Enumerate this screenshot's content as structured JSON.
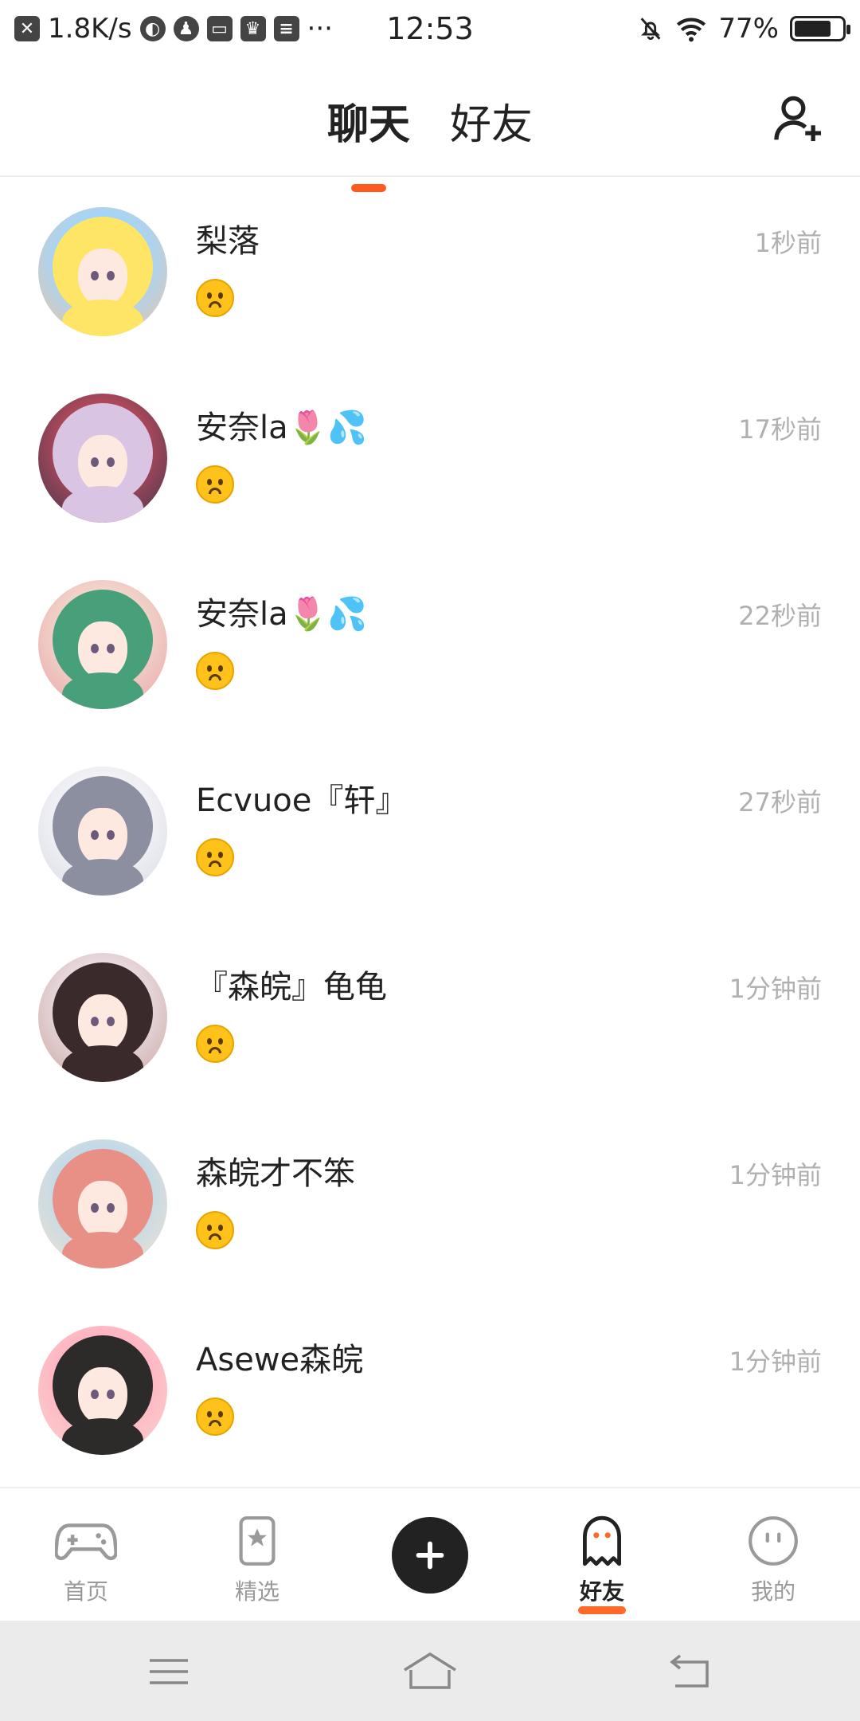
{
  "status_bar": {
    "speed": "1.8K/s",
    "more": "···",
    "time": "12:53",
    "battery": "77%",
    "battery_level": 0.77
  },
  "header": {
    "tabs": [
      {
        "label": "聊天",
        "active": true
      },
      {
        "label": "好友",
        "active": false
      }
    ]
  },
  "chats": [
    {
      "name": "梨落",
      "time": "1秒前",
      "avatar_colors": [
        "#f3c39a",
        "#ffe566",
        "#9fd6ff"
      ]
    },
    {
      "name": "安奈la🌷💦",
      "time": "17秒前",
      "avatar_colors": [
        "#3b3450",
        "#d9c4e3",
        "#b34a5a"
      ]
    },
    {
      "name": "安奈la🌷💦",
      "time": "22秒前",
      "avatar_colors": [
        "#e9a3a8",
        "#48a07a",
        "#f2d6cc"
      ]
    },
    {
      "name": "Ecvuoe『轩』",
      "time": "27秒前",
      "avatar_colors": [
        "#d9dbe6",
        "#8b8fa0",
        "#f3f3f6"
      ]
    },
    {
      "name": "『森皖』龟龟",
      "time": "1分钟前",
      "avatar_colors": [
        "#caa39a",
        "#3a2a2c",
        "#e9dce2"
      ]
    },
    {
      "name": "森皖才不笨",
      "time": "1分钟前",
      "avatar_colors": [
        "#f6e2cf",
        "#e88f86",
        "#bfd9e8"
      ]
    },
    {
      "name": "Asewe森皖",
      "time": "1分钟前",
      "avatar_colors": [
        "#f7d6d0",
        "#2d2a2a",
        "#ffb3c1"
      ]
    }
  ],
  "bottom_nav": {
    "items": [
      {
        "label": "首页",
        "icon": "gamepad-icon"
      },
      {
        "label": "精选",
        "icon": "bookmark-star-icon"
      },
      {
        "label": "",
        "icon": "plus-icon"
      },
      {
        "label": "好友",
        "icon": "ghost-icon",
        "active": true
      },
      {
        "label": "我的",
        "icon": "smiley-icon"
      }
    ]
  },
  "colors": {
    "accent": "#ff5a1f",
    "time_gray": "#b0b0b0",
    "nav_gray": "#9a9a9a"
  }
}
